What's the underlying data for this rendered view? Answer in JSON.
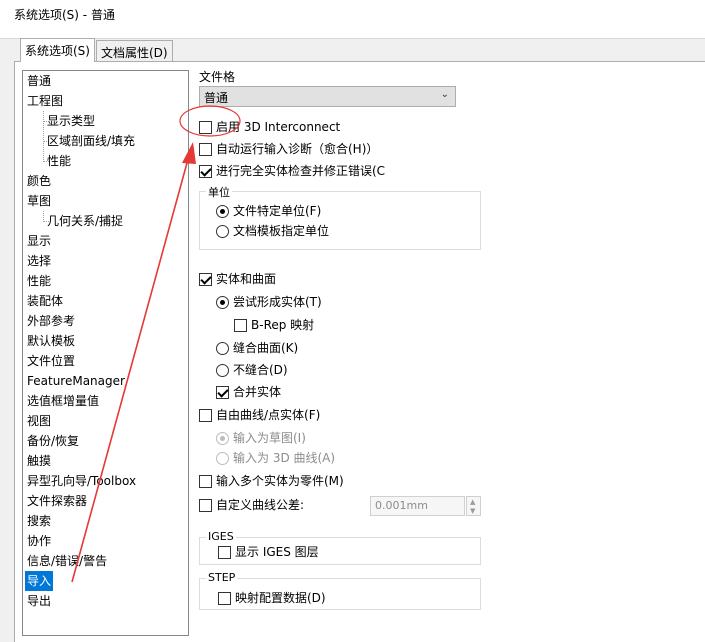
{
  "window": {
    "title": "系统选项(S) - 普通"
  },
  "tabs": [
    {
      "label": "系统选项(S)",
      "active": true
    },
    {
      "label": "文档属性(D)",
      "active": false
    }
  ],
  "tree": {
    "items": [
      {
        "label": "普通",
        "level": 0
      },
      {
        "label": "工程图",
        "level": 0
      },
      {
        "label": "显示类型",
        "level": 1
      },
      {
        "label": "区域剖面线/填充",
        "level": 1
      },
      {
        "label": "性能",
        "level": 1
      },
      {
        "label": "颜色",
        "level": 0
      },
      {
        "label": "草图",
        "level": 0
      },
      {
        "label": "几何关系/捕捉",
        "level": 1
      },
      {
        "label": "显示",
        "level": 0
      },
      {
        "label": "选择",
        "level": 0
      },
      {
        "label": "性能",
        "level": 0
      },
      {
        "label": "装配体",
        "level": 0
      },
      {
        "label": "外部参考",
        "level": 0
      },
      {
        "label": "默认模板",
        "level": 0
      },
      {
        "label": "文件位置",
        "level": 0
      },
      {
        "label": "FeatureManager",
        "level": 0
      },
      {
        "label": "选值框增量值",
        "level": 0
      },
      {
        "label": "视图",
        "level": 0
      },
      {
        "label": "备份/恢复",
        "level": 0
      },
      {
        "label": "触摸",
        "level": 0
      },
      {
        "label": "异型孔向导/Toolbox",
        "level": 0
      },
      {
        "label": "文件探索器",
        "level": 0
      },
      {
        "label": "搜索",
        "level": 0
      },
      {
        "label": "协作",
        "level": 0
      },
      {
        "label": "信息/错误/警告",
        "level": 0
      },
      {
        "label": "导入",
        "level": 0,
        "selected": true
      },
      {
        "label": "导出",
        "level": 0
      }
    ]
  },
  "options": {
    "file_format_label": "文件格",
    "file_format_value": "普通",
    "enable_3d_interconnect": "启用 3D Interconnect",
    "auto_diagnose": "自动运行输入诊断（愈合(H)）",
    "full_check": "进行完全实体检查并修正错误(C",
    "units_group": "单位",
    "unit_file_specific": "文件特定单位(F)",
    "unit_template": "文档模板指定单位",
    "solid_surface": "实体和曲面",
    "try_form_solid": "尝试形成实体(T)",
    "brep_mapping": "B-Rep 映射",
    "knit_surfaces": "缝合曲面(K)",
    "no_knit": "不缝合(D)",
    "merge_solids": "合并实体",
    "free_curves": "自由曲线/点实体(F)",
    "import_as_sketch": "输入为草图(I)",
    "import_as_3d_curve": "输入为 3D 曲线(A)",
    "import_multi_body": "输入多个实体为零件(M)",
    "custom_tolerance": "自定义曲线公差:",
    "tolerance_value": "0.001mm",
    "iges_group": "IGES",
    "show_iges_layers": "显示 IGES 图层",
    "step_group": "STEP",
    "map_config_data": "映射配置数据(D)"
  },
  "state": {
    "enable_3d_interconnect": false,
    "auto_diagnose": false,
    "full_check": true,
    "unit_file_specific": true,
    "unit_template": false,
    "solid_surface": true,
    "try_form_solid": true,
    "brep_mapping": false,
    "knit_surfaces": false,
    "no_knit": false,
    "merge_solids": true,
    "free_curves": false,
    "import_as_sketch": true,
    "import_as_3d_curve": false,
    "import_multi_body": false,
    "custom_tolerance": false,
    "show_iges_layers": false,
    "map_config_data": false
  },
  "colors": {
    "selection": "#0078d7",
    "annotation": "#e53935"
  }
}
